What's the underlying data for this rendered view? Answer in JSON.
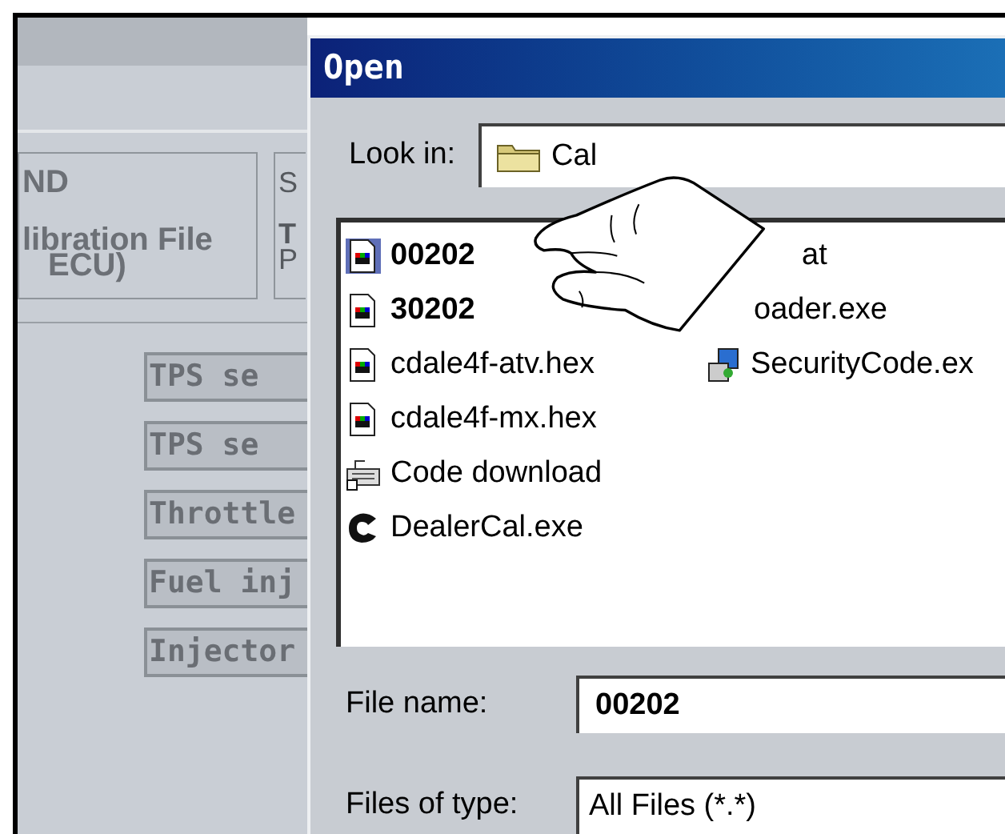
{
  "background_app": {
    "panel_texts": [
      "ND",
      "libration File",
      "ECU)"
    ],
    "side_panel_texts": [
      "S",
      "T",
      "P"
    ],
    "buttons": [
      "TPS se",
      "TPS se",
      "Throttle",
      "Fuel inj",
      "Injector"
    ]
  },
  "dialog": {
    "title": "Open",
    "look_in": {
      "label": "Look in:",
      "value": "Cal"
    },
    "files": [
      {
        "name": "00202",
        "kind": "hex",
        "bold": true,
        "selected": true
      },
      {
        "name": "30202",
        "kind": "hex",
        "bold": true,
        "selected": false
      },
      {
        "name": "cdale4f-atv.hex",
        "kind": "hex",
        "bold": false,
        "selected": false
      },
      {
        "name": "cdale4f-mx.hex",
        "kind": "hex",
        "bold": false,
        "selected": false
      },
      {
        "name": "Code download",
        "kind": "shortcut",
        "bold": false,
        "selected": false
      },
      {
        "name": "DealerCal.exe",
        "kind": "app",
        "bold": false,
        "selected": false
      },
      {
        "name": "at",
        "kind": "covered_far",
        "bold": false,
        "selected": false
      },
      {
        "name": "oader.exe",
        "kind": "covered",
        "bold": false,
        "selected": false
      },
      {
        "name": "SecurityCode.ex",
        "kind": "exe",
        "bold": false,
        "selected": false
      }
    ],
    "file_name": {
      "label": "File name:",
      "value": "00202"
    },
    "files_of_type": {
      "label": "Files of type:",
      "value": "All Files (*.*)"
    }
  }
}
